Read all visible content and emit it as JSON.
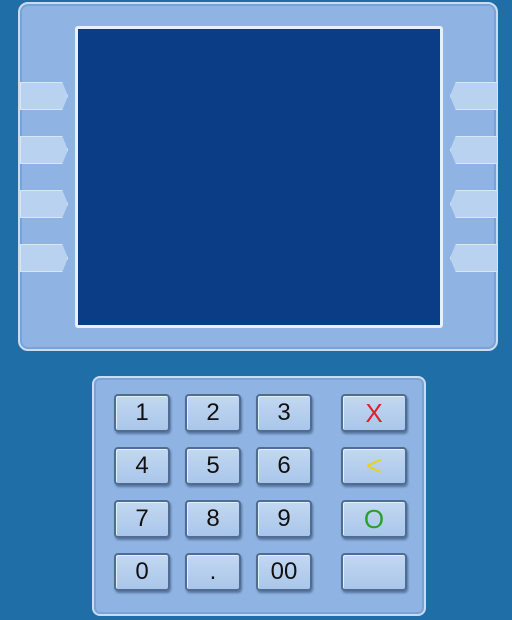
{
  "keypad": {
    "digits": [
      "1",
      "2",
      "3",
      "4",
      "5",
      "6",
      "7",
      "8",
      "9",
      "0",
      ".",
      "00"
    ],
    "functions": {
      "cancel": "X",
      "clear": "<",
      "enter": "O",
      "blank": ""
    }
  },
  "colors": {
    "background": "#1f6ea8",
    "panel": "#8fb4e3",
    "screen": "#0b3c86",
    "cancel": "#e0202a",
    "clear": "#e8d21a",
    "enter": "#2aa02a"
  }
}
